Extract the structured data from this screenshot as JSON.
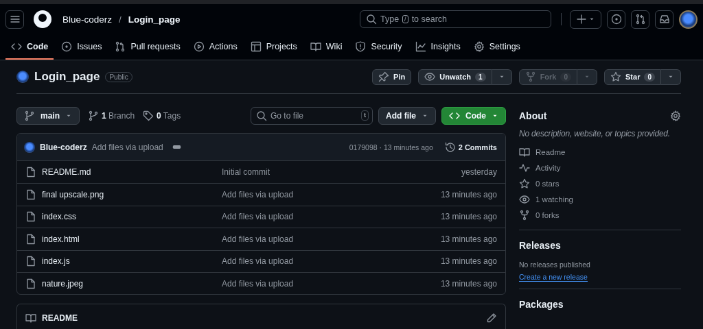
{
  "header": {
    "owner": "Blue-coderz",
    "separator": "/",
    "repo": "Login_page",
    "search": {
      "prefix": "Type",
      "key": "/",
      "suffix": "to search"
    }
  },
  "tabs": [
    {
      "label": "Code",
      "selected": true
    },
    {
      "label": "Issues",
      "selected": false
    },
    {
      "label": "Pull requests",
      "selected": false
    },
    {
      "label": "Actions",
      "selected": false
    },
    {
      "label": "Projects",
      "selected": false
    },
    {
      "label": "Wiki",
      "selected": false
    },
    {
      "label": "Security",
      "selected": false
    },
    {
      "label": "Insights",
      "selected": false
    },
    {
      "label": "Settings",
      "selected": false
    }
  ],
  "repo": {
    "name": "Login_page",
    "visibility": "Public",
    "actions": [
      {
        "label": "Pin",
        "disabled": false
      },
      {
        "label": "Unwatch",
        "count": "1",
        "disabled": false
      },
      {
        "label": "Fork",
        "count": "0",
        "disabled": true
      },
      {
        "label": "Star",
        "count": "0",
        "disabled": false
      }
    ]
  },
  "toolbar": {
    "branch": "main",
    "branch_count": "1",
    "branch_label": "Branch",
    "tag_count": "0",
    "tag_label": "Tags",
    "goto": {
      "placeholder": "Go to file",
      "key": "t"
    },
    "add_file": "Add file",
    "code": "Code"
  },
  "commit": {
    "author": "Blue-coderz",
    "message": "Add files via upload",
    "meta": "0179098 · 13 minutes ago",
    "count": "2",
    "count_label": "Commits"
  },
  "files": [
    {
      "name": "README.md",
      "message": "Initial commit",
      "time": "yesterday"
    },
    {
      "name": "final upscale.png",
      "message": "Add files via upload",
      "time": "13 minutes ago"
    },
    {
      "name": "index.css",
      "message": "Add files via upload",
      "time": "13 minutes ago"
    },
    {
      "name": "index.html",
      "message": "Add files via upload",
      "time": "13 minutes ago"
    },
    {
      "name": "index.js",
      "message": "Add files via upload",
      "time": "13 minutes ago"
    },
    {
      "name": "nature.jpeg",
      "message": "Add files via upload",
      "time": "13 minutes ago"
    }
  ],
  "readme": {
    "title": "README"
  },
  "about": {
    "title": "About",
    "description": "No description, website, or topics provided.",
    "links": [
      {
        "text": "Readme"
      },
      {
        "text": "Activity"
      },
      {
        "text": "0 stars"
      },
      {
        "text": "1 watching"
      },
      {
        "text": "0 forks"
      }
    ]
  },
  "releases": {
    "title": "Releases",
    "note": "No releases published",
    "link": "Create a new release"
  },
  "packages": {
    "title": "Packages"
  }
}
